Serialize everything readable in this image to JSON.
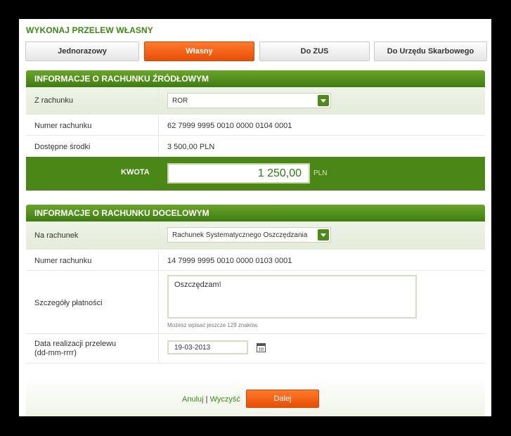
{
  "page": {
    "title": "WYKONAJ PRZELEW WŁASNY"
  },
  "tabs": [
    {
      "label": "Jednorazowy",
      "active": false
    },
    {
      "label": "Własny",
      "active": true
    },
    {
      "label": "Do ZUS",
      "active": false
    },
    {
      "label": "Do Urzędu Skarbowego",
      "active": false
    }
  ],
  "source": {
    "header": "INFORMACJE O RACHUNKU ŹRÓDŁOWYM",
    "from_label": "Z rachunku",
    "from_value": "ROR",
    "number_label": "Numer rachunku",
    "number_value": "62 7999 9995 0010 0000 0104 0001",
    "funds_label": "Dostępne środki",
    "funds_value": "3 500,00 PLN"
  },
  "amount": {
    "label": "KWOTA",
    "value": "1 250,00",
    "currency": "PLN"
  },
  "target": {
    "header": "INFORMACJE O RACHUNKU DOCELOWYM",
    "to_label": "Na rachunek",
    "to_value": "Rachunek Systematycznego Oszczędzania",
    "number_label": "Numer rachunku",
    "number_value": "14 7999 9995 0010 0000 0103 0001",
    "details_label": "Szczegóły płatności",
    "details_value": "Oszczędzam!",
    "details_hint": "Możesz wpisać jeszcze 129 znaków.",
    "date_label_line1": "Data realizacji przelewu",
    "date_label_line2": "(dd-mm-rrrr)",
    "date_value": "19-03-2013"
  },
  "footer": {
    "cancel": "Anuluj",
    "separator": "|",
    "clear": "Wyczyść",
    "next": "Dalej"
  },
  "colors": {
    "brand_green": "#4a8716",
    "accent_orange": "#f15a0f"
  }
}
